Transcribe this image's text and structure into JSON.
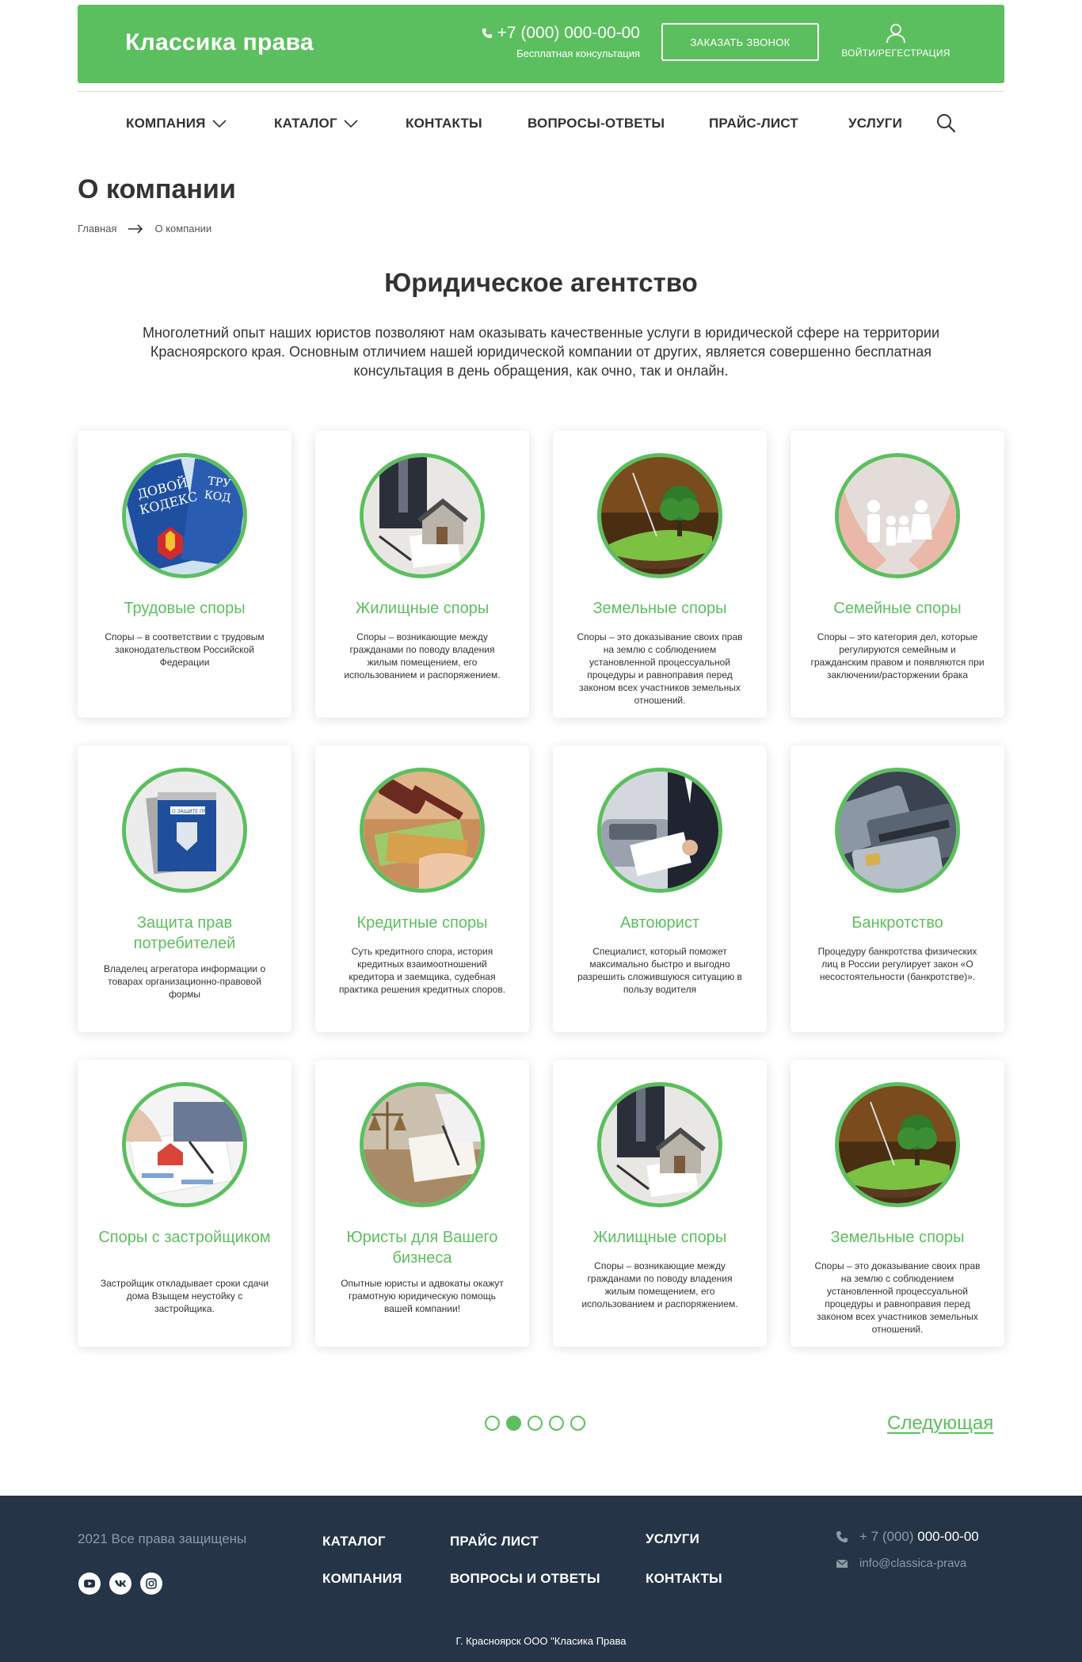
{
  "header": {
    "logo": "Классика права",
    "phone": "+7 (000) 000-00-00",
    "phone_sub": "Бесплатная консультация",
    "callback_label": "ЗАКАЗАТЬ ЗВОНОК",
    "login_label": "ВОЙТИ/РЕГЕСТРАЦИЯ",
    "accent_color": "#5cbf5f"
  },
  "nav": {
    "items": [
      {
        "label": "КОМПАНИЯ",
        "icon": "chevron-down-icon"
      },
      {
        "label": "КАТАЛОГ",
        "icon": "chevron-down-icon"
      },
      {
        "label": "КОНТАКТЫ"
      },
      {
        "label": "ВОПРОСЫ-ОТВЕТЫ"
      },
      {
        "label": "ПРАЙС-ЛИСТ"
      },
      {
        "label": "УСЛУГИ"
      }
    ],
    "search_icon": "search-icon"
  },
  "page": {
    "title": "О компании",
    "breadcrumb": [
      "Главная",
      "О компании"
    ],
    "section_title": "Юридическое агентство",
    "intro": "Многолетний опыт наших юристов позволяют нам оказывать качественные услуги в юридической сфере на территории Красноярского края. Основным отличием нашей юридической компании от других, является совершенно бесплатная консультация в день обращения, как очно, так и онлайн."
  },
  "cards": [
    {
      "title": "Трудовые споры",
      "desc": "Споры – в соответствии с трудовым законодательством Российской Федерации"
    },
    {
      "title": "Жилищные споры",
      "desc": "Споры –  возникающие между гражданами по поводу владения жилым помещением, его использованием и распоряжением."
    },
    {
      "title": "Земельные споры",
      "desc": "Споры – это доказывание своих прав на землю с соблюдением установленной процессуальной процедуры и равноправия перед законом всех участников земельных отношений."
    },
    {
      "title": "Семейные споры",
      "desc": "Споры – это категория дел, которые регулируются семейным и гражданским правом и появляются при заключении/расторжении брака"
    },
    {
      "title": "Защита прав потребителей",
      "desc": "Владелец агрегатора информации о товарах организационно-правовой формы"
    },
    {
      "title": "Кредитные споры",
      "desc": "Суть кредитного спора, история кредитных взаимоотношений кредитора и заемщика, судебная практика решения кредитных споров."
    },
    {
      "title": "Автоюрист",
      "desc": "Специалист, который поможет максимально быстро и выгодно разрешить сложившуюся ситуацию в пользу водителя"
    },
    {
      "title": "Банкротство",
      "desc": "Процедуру банкротства физических лиц в России регулирует закон «О несостоятельности (банкротстве)»."
    },
    {
      "title": "Споры с застройщиком",
      "desc": "Застройщик откладывает сроки сдачи дома Взыщем неустойку с застройщика."
    },
    {
      "title": "Юристы для Вашего бизнеса",
      "desc": "Опытные юристы и адвокаты окажут грамотную юридическую помощь вашей компании!"
    },
    {
      "title": "Жилищные споры",
      "desc": "Споры –  возникающие между гражданами по поводу владения жилым помещением, его использованием и распоряжением."
    },
    {
      "title": "Земельные споры",
      "desc": "Споры – это доказывание своих прав на землю с соблюдением установленной процессуальной процедуры и равноправия перед законом всех участников земельных отношений."
    }
  ],
  "pagination": {
    "pages": 5,
    "current_page": 2,
    "next_label": "Следующая"
  },
  "footer": {
    "copyright": "2021 Все права защищены",
    "links": [
      "КАТАЛОГ",
      "ПРАЙС ЛИСТ",
      "УСЛУГИ",
      "КОМПАНИЯ",
      "ВОПРОСЫ И ОТВЕТЫ",
      "КОНТАКТЫ"
    ],
    "phone_prefix": "+ 7 (000)",
    "phone_number": "000-00-00",
    "email": "info@classica-prava",
    "address": "Г. Красноярск  ООО \"Класика Права",
    "socials": [
      "youtube-icon",
      "vk-icon",
      "instagram-icon"
    ],
    "background": "#253447"
  }
}
